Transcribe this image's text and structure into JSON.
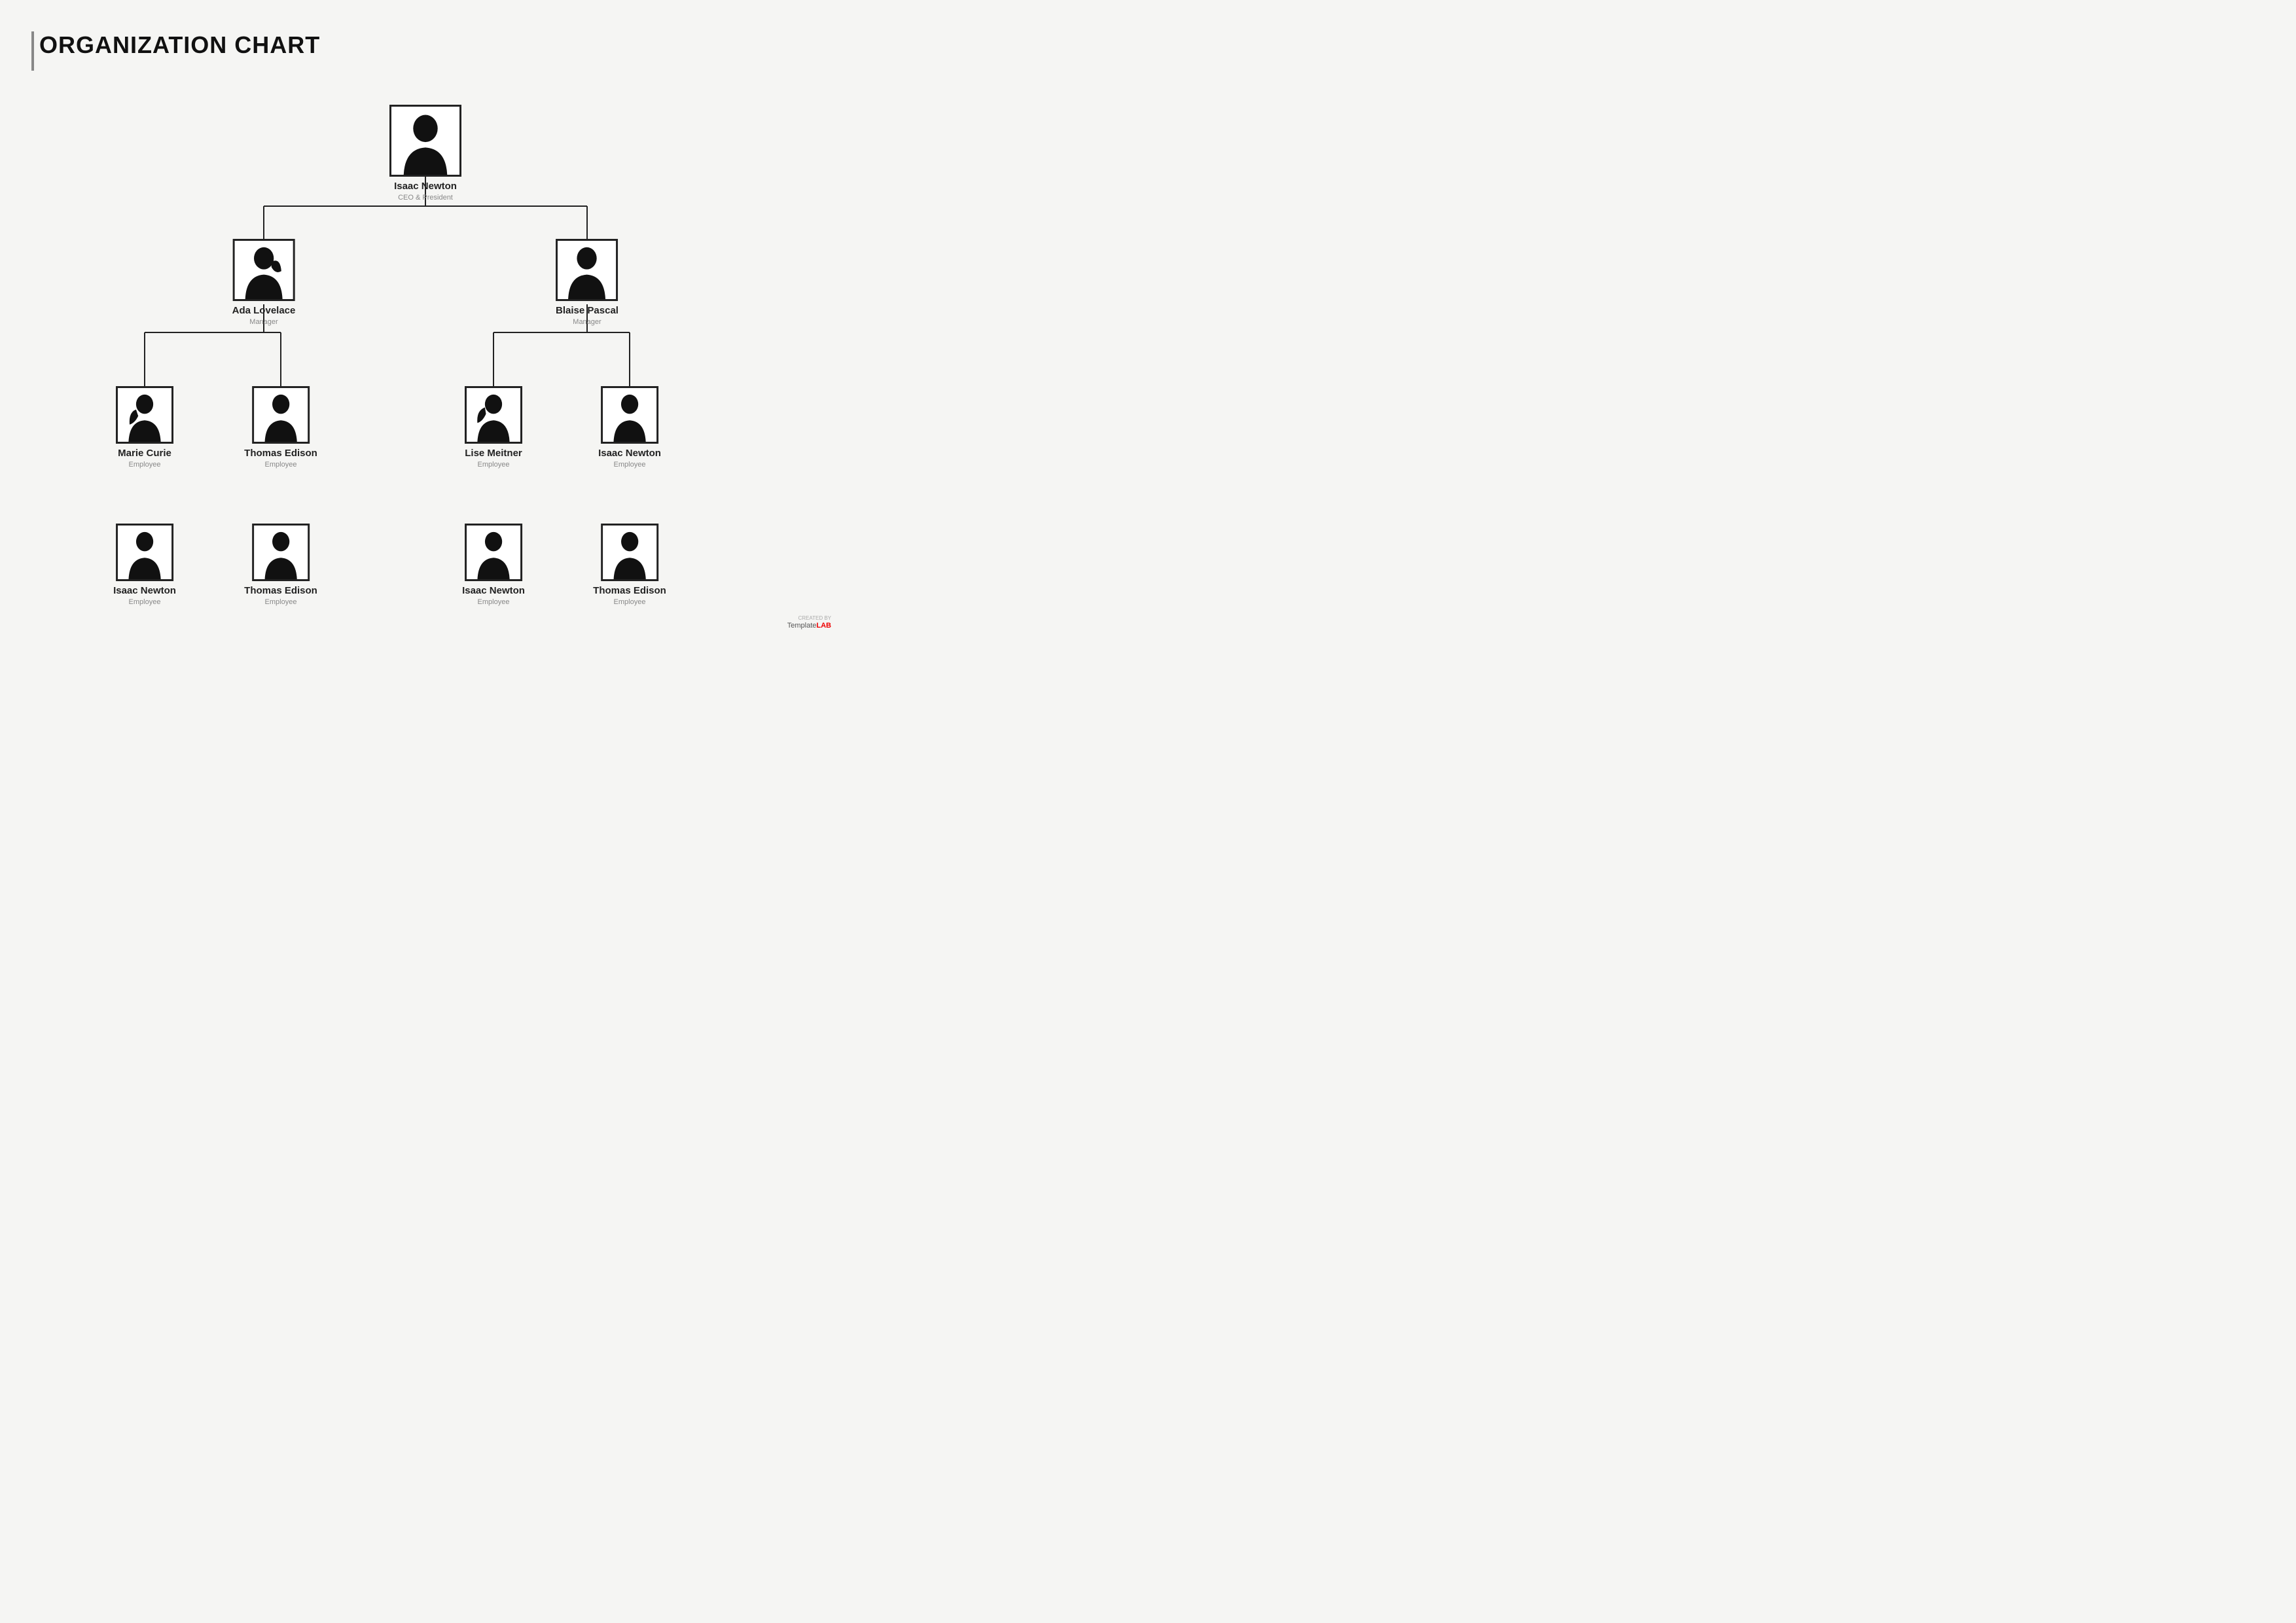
{
  "page": {
    "title": "ORGANIZATION CHART",
    "background": "#f5f5f3"
  },
  "nodes": {
    "ceo": {
      "name": "Isaac Newton",
      "title": "CEO & President",
      "level": "large"
    },
    "manager_left": {
      "name": "Ada Lovelace",
      "title": "Manager",
      "level": "medium"
    },
    "manager_right": {
      "name": "Blaise Pascal",
      "title": "Manager",
      "level": "medium"
    },
    "emp1": {
      "name": "Marie Curie",
      "title": "Employee",
      "level": "small"
    },
    "emp2": {
      "name": "Thomas Edison",
      "title": "Employee",
      "level": "small"
    },
    "emp3": {
      "name": "Lise Meitner",
      "title": "Employee",
      "level": "small"
    },
    "emp4": {
      "name": "Isaac Newton",
      "title": "Employee",
      "level": "small"
    },
    "emp5": {
      "name": "Isaac Newton",
      "title": "Employee",
      "level": "small"
    },
    "emp6": {
      "name": "Thomas Edison",
      "title": "Employee",
      "level": "small"
    },
    "emp7": {
      "name": "Isaac Newton",
      "title": "Employee",
      "level": "small"
    },
    "emp8": {
      "name": "Thomas Edison",
      "title": "Employee",
      "level": "small"
    }
  },
  "logo": {
    "created_by": "CREATED BY",
    "template": "Template",
    "lab": "LAB"
  }
}
